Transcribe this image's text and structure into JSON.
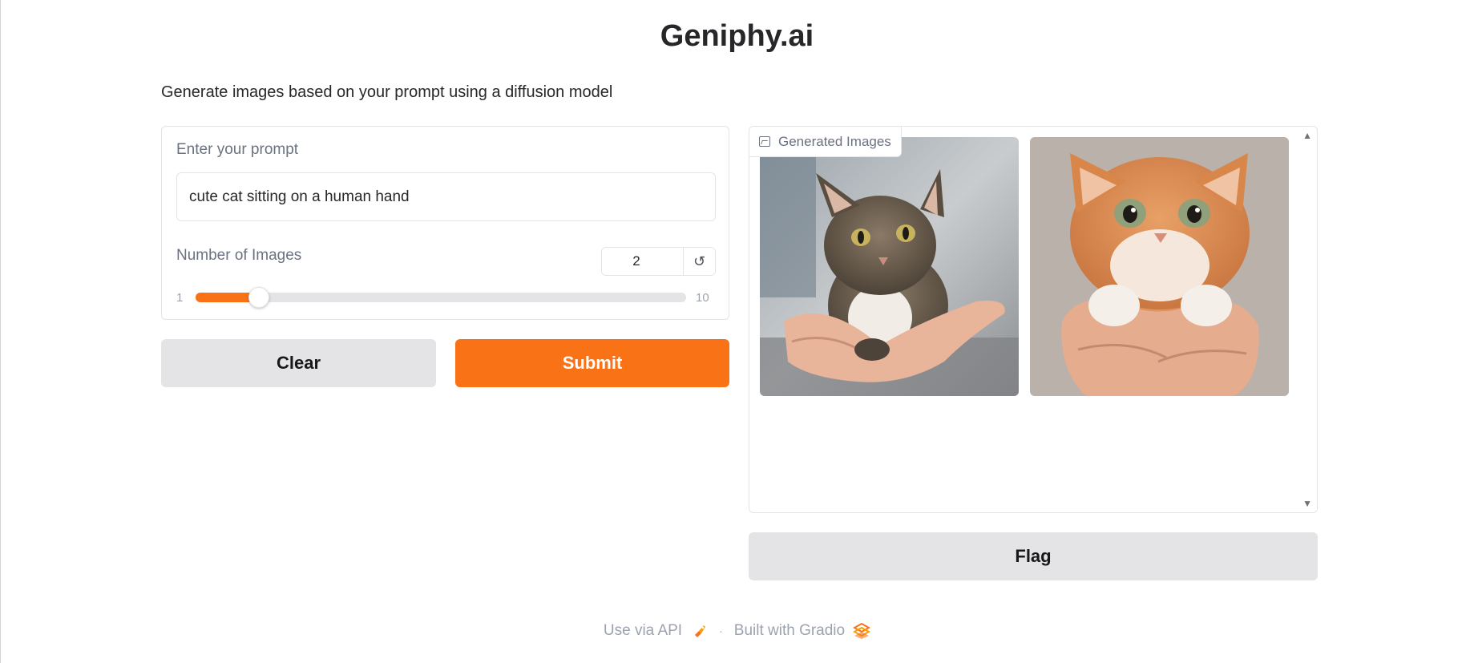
{
  "app": {
    "title": "Geniphy.ai",
    "description": "Generate images based on your prompt using a diffusion model"
  },
  "prompt": {
    "label": "Enter your prompt",
    "value": "cute cat sitting on a human hand"
  },
  "num_images": {
    "label": "Number of Images",
    "value": "2",
    "min_label": "1",
    "max_label": "10",
    "min": 1,
    "max": 10,
    "current": 2,
    "reset_icon": "reset-icon"
  },
  "buttons": {
    "clear": "Clear",
    "submit": "Submit",
    "flag": "Flag"
  },
  "gallery": {
    "label": "Generated Images",
    "label_icon": "image-icon",
    "images": [
      {
        "subject": "tabby kitten on hand"
      },
      {
        "subject": "orange kitten held in hands"
      }
    ]
  },
  "footer": {
    "api": "Use via API",
    "separator": "·",
    "built": "Built with Gradio"
  },
  "colors": {
    "accent": "#f97316",
    "secondary_button": "#e4e4e7",
    "border": "#e4e4e7",
    "muted_text": "#6b7280"
  }
}
